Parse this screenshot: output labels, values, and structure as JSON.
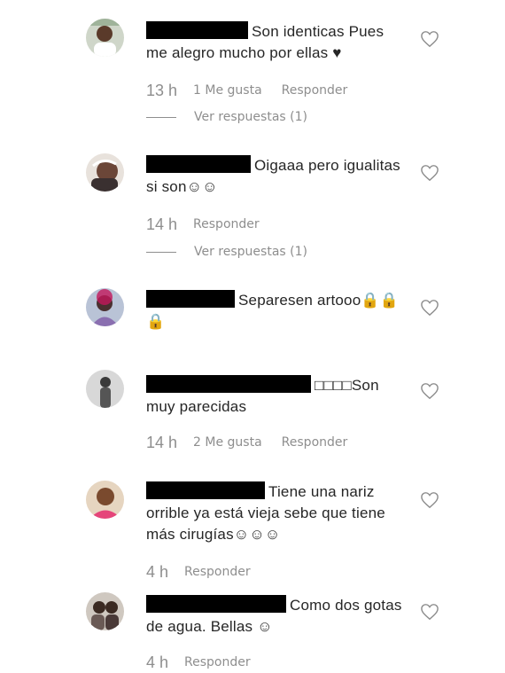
{
  "comments": [
    {
      "text": "Son identicas Pues me alegro mucho por ellas ♥",
      "time": "13 h",
      "likes": "1 Me gusta",
      "reply": "Responder",
      "view_replies": "Ver respuestas (1)"
    },
    {
      "text": "Oigaaa pero igualitas si son☺☺",
      "time": "14 h",
      "reply": "Responder",
      "view_replies": "Ver respuestas (1)"
    },
    {
      "text": "Separesen artooo🔒🔒 🔒"
    },
    {
      "text": "□□□□Son muy parecidas",
      "time": "14 h",
      "likes": "2 Me gusta",
      "reply": "Responder"
    },
    {
      "text": "Tiene una nariz orrible ya está vieja sebe que tiene más cirugías☺☺☺",
      "time": "4 h",
      "reply": "Responder"
    },
    {
      "text": "Como dos gotas de agua. Bellas ☺",
      "time": "4 h",
      "reply": "Responder"
    }
  ],
  "icons": {
    "like": "heart-outline-icon"
  },
  "colors": {
    "text": "#262626",
    "secondary": "#8e8e8e",
    "redaction": "#000000"
  }
}
